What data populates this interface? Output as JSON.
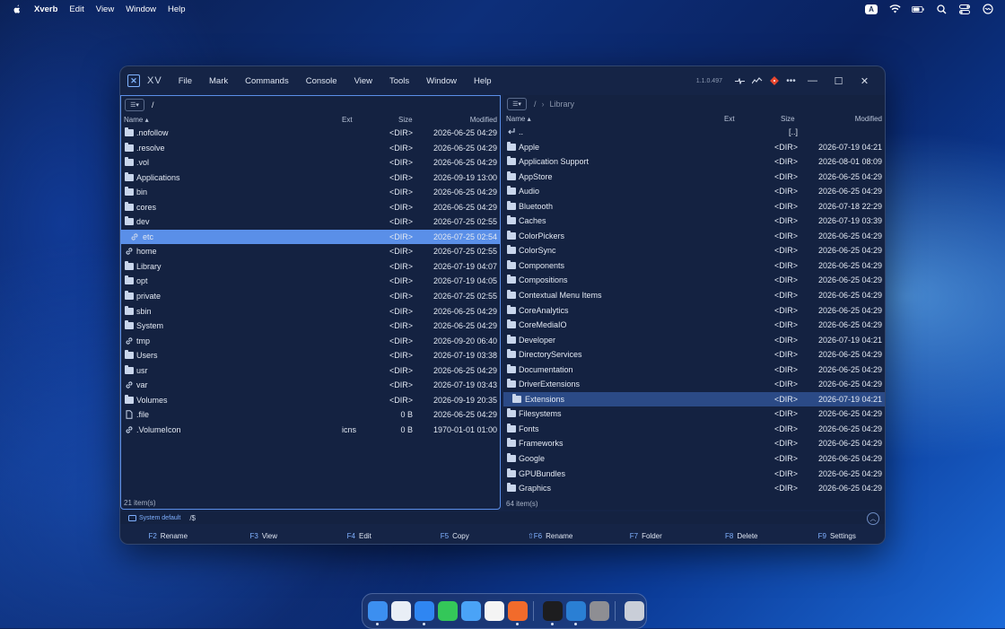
{
  "menubar": {
    "app": "Xverb",
    "items": [
      "Edit",
      "View",
      "Window",
      "Help"
    ],
    "input_badge": "A"
  },
  "window": {
    "title": "XV",
    "menu": [
      "File",
      "Mark",
      "Commands",
      "Console",
      "View",
      "Tools",
      "Window",
      "Help"
    ],
    "version": "1.1.0.497"
  },
  "left_pane": {
    "path": "/",
    "columns": {
      "name": "Name",
      "ext": "Ext",
      "size": "Size",
      "modified": "Modified"
    },
    "rows": [
      {
        "icon": "folder-icon",
        "name": ".nofollow",
        "ext": "",
        "size": "<DIR>",
        "modified": "2026-06-25 04:29"
      },
      {
        "icon": "folder-icon",
        "name": ".resolve",
        "ext": "",
        "size": "<DIR>",
        "modified": "2026-06-25 04:29"
      },
      {
        "icon": "folder-icon",
        "name": ".vol",
        "ext": "",
        "size": "<DIR>",
        "modified": "2026-06-25 04:29"
      },
      {
        "icon": "folder-icon",
        "name": "Applications",
        "ext": "",
        "size": "<DIR>",
        "modified": "2026-09-19 13:00"
      },
      {
        "icon": "folder-icon",
        "name": "bin",
        "ext": "",
        "size": "<DIR>",
        "modified": "2026-06-25 04:29"
      },
      {
        "icon": "folder-icon",
        "name": "cores",
        "ext": "",
        "size": "<DIR>",
        "modified": "2026-06-25 04:29"
      },
      {
        "icon": "folder-icon",
        "name": "dev",
        "ext": "",
        "size": "<DIR>",
        "modified": "2026-07-25 02:55"
      },
      {
        "icon": "link-icon",
        "name": "etc",
        "ext": "",
        "size": "<DIR>",
        "modified": "2026-07-25 02:54",
        "selected": true
      },
      {
        "icon": "link-icon",
        "name": "home",
        "ext": "",
        "size": "<DIR>",
        "modified": "2026-07-25 02:55"
      },
      {
        "icon": "folder-icon",
        "name": "Library",
        "ext": "",
        "size": "<DIR>",
        "modified": "2026-07-19 04:07"
      },
      {
        "icon": "folder-icon",
        "name": "opt",
        "ext": "",
        "size": "<DIR>",
        "modified": "2026-07-19 04:05"
      },
      {
        "icon": "folder-icon",
        "name": "private",
        "ext": "",
        "size": "<DIR>",
        "modified": "2026-07-25 02:55"
      },
      {
        "icon": "folder-icon",
        "name": "sbin",
        "ext": "",
        "size": "<DIR>",
        "modified": "2026-06-25 04:29"
      },
      {
        "icon": "folder-icon",
        "name": "System",
        "ext": "",
        "size": "<DIR>",
        "modified": "2026-06-25 04:29"
      },
      {
        "icon": "link-icon",
        "name": "tmp",
        "ext": "",
        "size": "<DIR>",
        "modified": "2026-09-20 06:40"
      },
      {
        "icon": "folder-icon",
        "name": "Users",
        "ext": "",
        "size": "<DIR>",
        "modified": "2026-07-19 03:38"
      },
      {
        "icon": "folder-icon",
        "name": "usr",
        "ext": "",
        "size": "<DIR>",
        "modified": "2026-06-25 04:29"
      },
      {
        "icon": "link-icon",
        "name": "var",
        "ext": "",
        "size": "<DIR>",
        "modified": "2026-07-19 03:43"
      },
      {
        "icon": "folder-icon",
        "name": "Volumes",
        "ext": "",
        "size": "<DIR>",
        "modified": "2026-09-19 20:35"
      },
      {
        "icon": "file-icon",
        "name": ".file",
        "ext": "",
        "size": "0 B",
        "modified": "2026-06-25 04:29"
      },
      {
        "icon": "link-icon",
        "name": ".VolumeIcon",
        "ext": "icns",
        "size": "0 B",
        "modified": "1970-01-01 01:00"
      }
    ],
    "status": "21 item(s)"
  },
  "right_pane": {
    "breadcrumb": [
      "/",
      "Library"
    ],
    "columns": {
      "name": "Name",
      "ext": "Ext",
      "size": "Size",
      "modified": "Modified"
    },
    "rows": [
      {
        "icon": "parent-icon",
        "name": "..",
        "ext": "",
        "size": "[..]",
        "modified": ""
      },
      {
        "icon": "folder-icon",
        "name": "Apple",
        "ext": "",
        "size": "<DIR>",
        "modified": "2026-07-19 04:21"
      },
      {
        "icon": "folder-icon",
        "name": "Application Support",
        "ext": "",
        "size": "<DIR>",
        "modified": "2026-08-01 08:09"
      },
      {
        "icon": "folder-icon",
        "name": "AppStore",
        "ext": "",
        "size": "<DIR>",
        "modified": "2026-06-25 04:29"
      },
      {
        "icon": "folder-icon",
        "name": "Audio",
        "ext": "",
        "size": "<DIR>",
        "modified": "2026-06-25 04:29"
      },
      {
        "icon": "folder-icon",
        "name": "Bluetooth",
        "ext": "",
        "size": "<DIR>",
        "modified": "2026-07-18 22:29"
      },
      {
        "icon": "folder-icon",
        "name": "Caches",
        "ext": "",
        "size": "<DIR>",
        "modified": "2026-07-19 03:39"
      },
      {
        "icon": "folder-icon",
        "name": "ColorPickers",
        "ext": "",
        "size": "<DIR>",
        "modified": "2026-06-25 04:29"
      },
      {
        "icon": "folder-icon",
        "name": "ColorSync",
        "ext": "",
        "size": "<DIR>",
        "modified": "2026-06-25 04:29"
      },
      {
        "icon": "folder-icon",
        "name": "Components",
        "ext": "",
        "size": "<DIR>",
        "modified": "2026-06-25 04:29"
      },
      {
        "icon": "folder-icon",
        "name": "Compositions",
        "ext": "",
        "size": "<DIR>",
        "modified": "2026-06-25 04:29"
      },
      {
        "icon": "folder-icon",
        "name": "Contextual Menu Items",
        "ext": "",
        "size": "<DIR>",
        "modified": "2026-06-25 04:29"
      },
      {
        "icon": "folder-icon",
        "name": "CoreAnalytics",
        "ext": "",
        "size": "<DIR>",
        "modified": "2026-06-25 04:29"
      },
      {
        "icon": "folder-icon",
        "name": "CoreMediaIO",
        "ext": "",
        "size": "<DIR>",
        "modified": "2026-06-25 04:29"
      },
      {
        "icon": "folder-icon",
        "name": "Developer",
        "ext": "",
        "size": "<DIR>",
        "modified": "2026-07-19 04:21"
      },
      {
        "icon": "folder-icon",
        "name": "DirectoryServices",
        "ext": "",
        "size": "<DIR>",
        "modified": "2026-06-25 04:29"
      },
      {
        "icon": "folder-icon",
        "name": "Documentation",
        "ext": "",
        "size": "<DIR>",
        "modified": "2026-06-25 04:29"
      },
      {
        "icon": "folder-icon",
        "name": "DriverExtensions",
        "ext": "",
        "size": "<DIR>",
        "modified": "2026-06-25 04:29"
      },
      {
        "icon": "folder-icon",
        "name": "Extensions",
        "ext": "",
        "size": "<DIR>",
        "modified": "2026-07-19 04:21",
        "selected": true
      },
      {
        "icon": "folder-icon",
        "name": "Filesystems",
        "ext": "",
        "size": "<DIR>",
        "modified": "2026-06-25 04:29"
      },
      {
        "icon": "folder-icon",
        "name": "Fonts",
        "ext": "",
        "size": "<DIR>",
        "modified": "2026-06-25 04:29"
      },
      {
        "icon": "folder-icon",
        "name": "Frameworks",
        "ext": "",
        "size": "<DIR>",
        "modified": "2026-06-25 04:29"
      },
      {
        "icon": "folder-icon",
        "name": "Google",
        "ext": "",
        "size": "<DIR>",
        "modified": "2026-06-25 04:29"
      },
      {
        "icon": "folder-icon",
        "name": "GPUBundles",
        "ext": "",
        "size": "<DIR>",
        "modified": "2026-06-25 04:29"
      },
      {
        "icon": "folder-icon",
        "name": "Graphics",
        "ext": "",
        "size": "<DIR>",
        "modified": "2026-06-25 04:29"
      }
    ],
    "status": "64 item(s)"
  },
  "cmdline": {
    "badge": "System default",
    "prompt": "/$"
  },
  "fkeys": [
    {
      "key": "F2",
      "label": "Rename"
    },
    {
      "key": "F3",
      "label": "View"
    },
    {
      "key": "F4",
      "label": "Edit"
    },
    {
      "key": "F5",
      "label": "Copy"
    },
    {
      "key": "⇧F6",
      "label": "Rename"
    },
    {
      "key": "F7",
      "label": "Folder"
    },
    {
      "key": "F8",
      "label": "Delete"
    },
    {
      "key": "F9",
      "label": "Settings"
    }
  ],
  "dock": [
    {
      "name": "finder-icon",
      "color": "#3c8ff0",
      "running": true
    },
    {
      "name": "launchpad-icon",
      "color": "#e9eef6",
      "running": false
    },
    {
      "name": "safari-icon",
      "color": "#2f86f2",
      "running": true
    },
    {
      "name": "messages-icon",
      "color": "#34c759",
      "running": false
    },
    {
      "name": "mail-icon",
      "color": "#4aa3f7",
      "running": false
    },
    {
      "name": "photos-icon",
      "color": "#f4f4f4",
      "running": false
    },
    {
      "name": "xverb-icon",
      "color": "#f26b2b",
      "running": true
    },
    {
      "name": "terminal-icon",
      "color": "#1d1d1f",
      "running": true
    },
    {
      "name": "vscode-icon",
      "color": "#2a7fd4",
      "running": true
    },
    {
      "name": "system-settings-icon",
      "color": "#8e8e93",
      "running": false
    },
    {
      "name": "trash-icon",
      "color": "#c9ced8",
      "running": false
    }
  ]
}
